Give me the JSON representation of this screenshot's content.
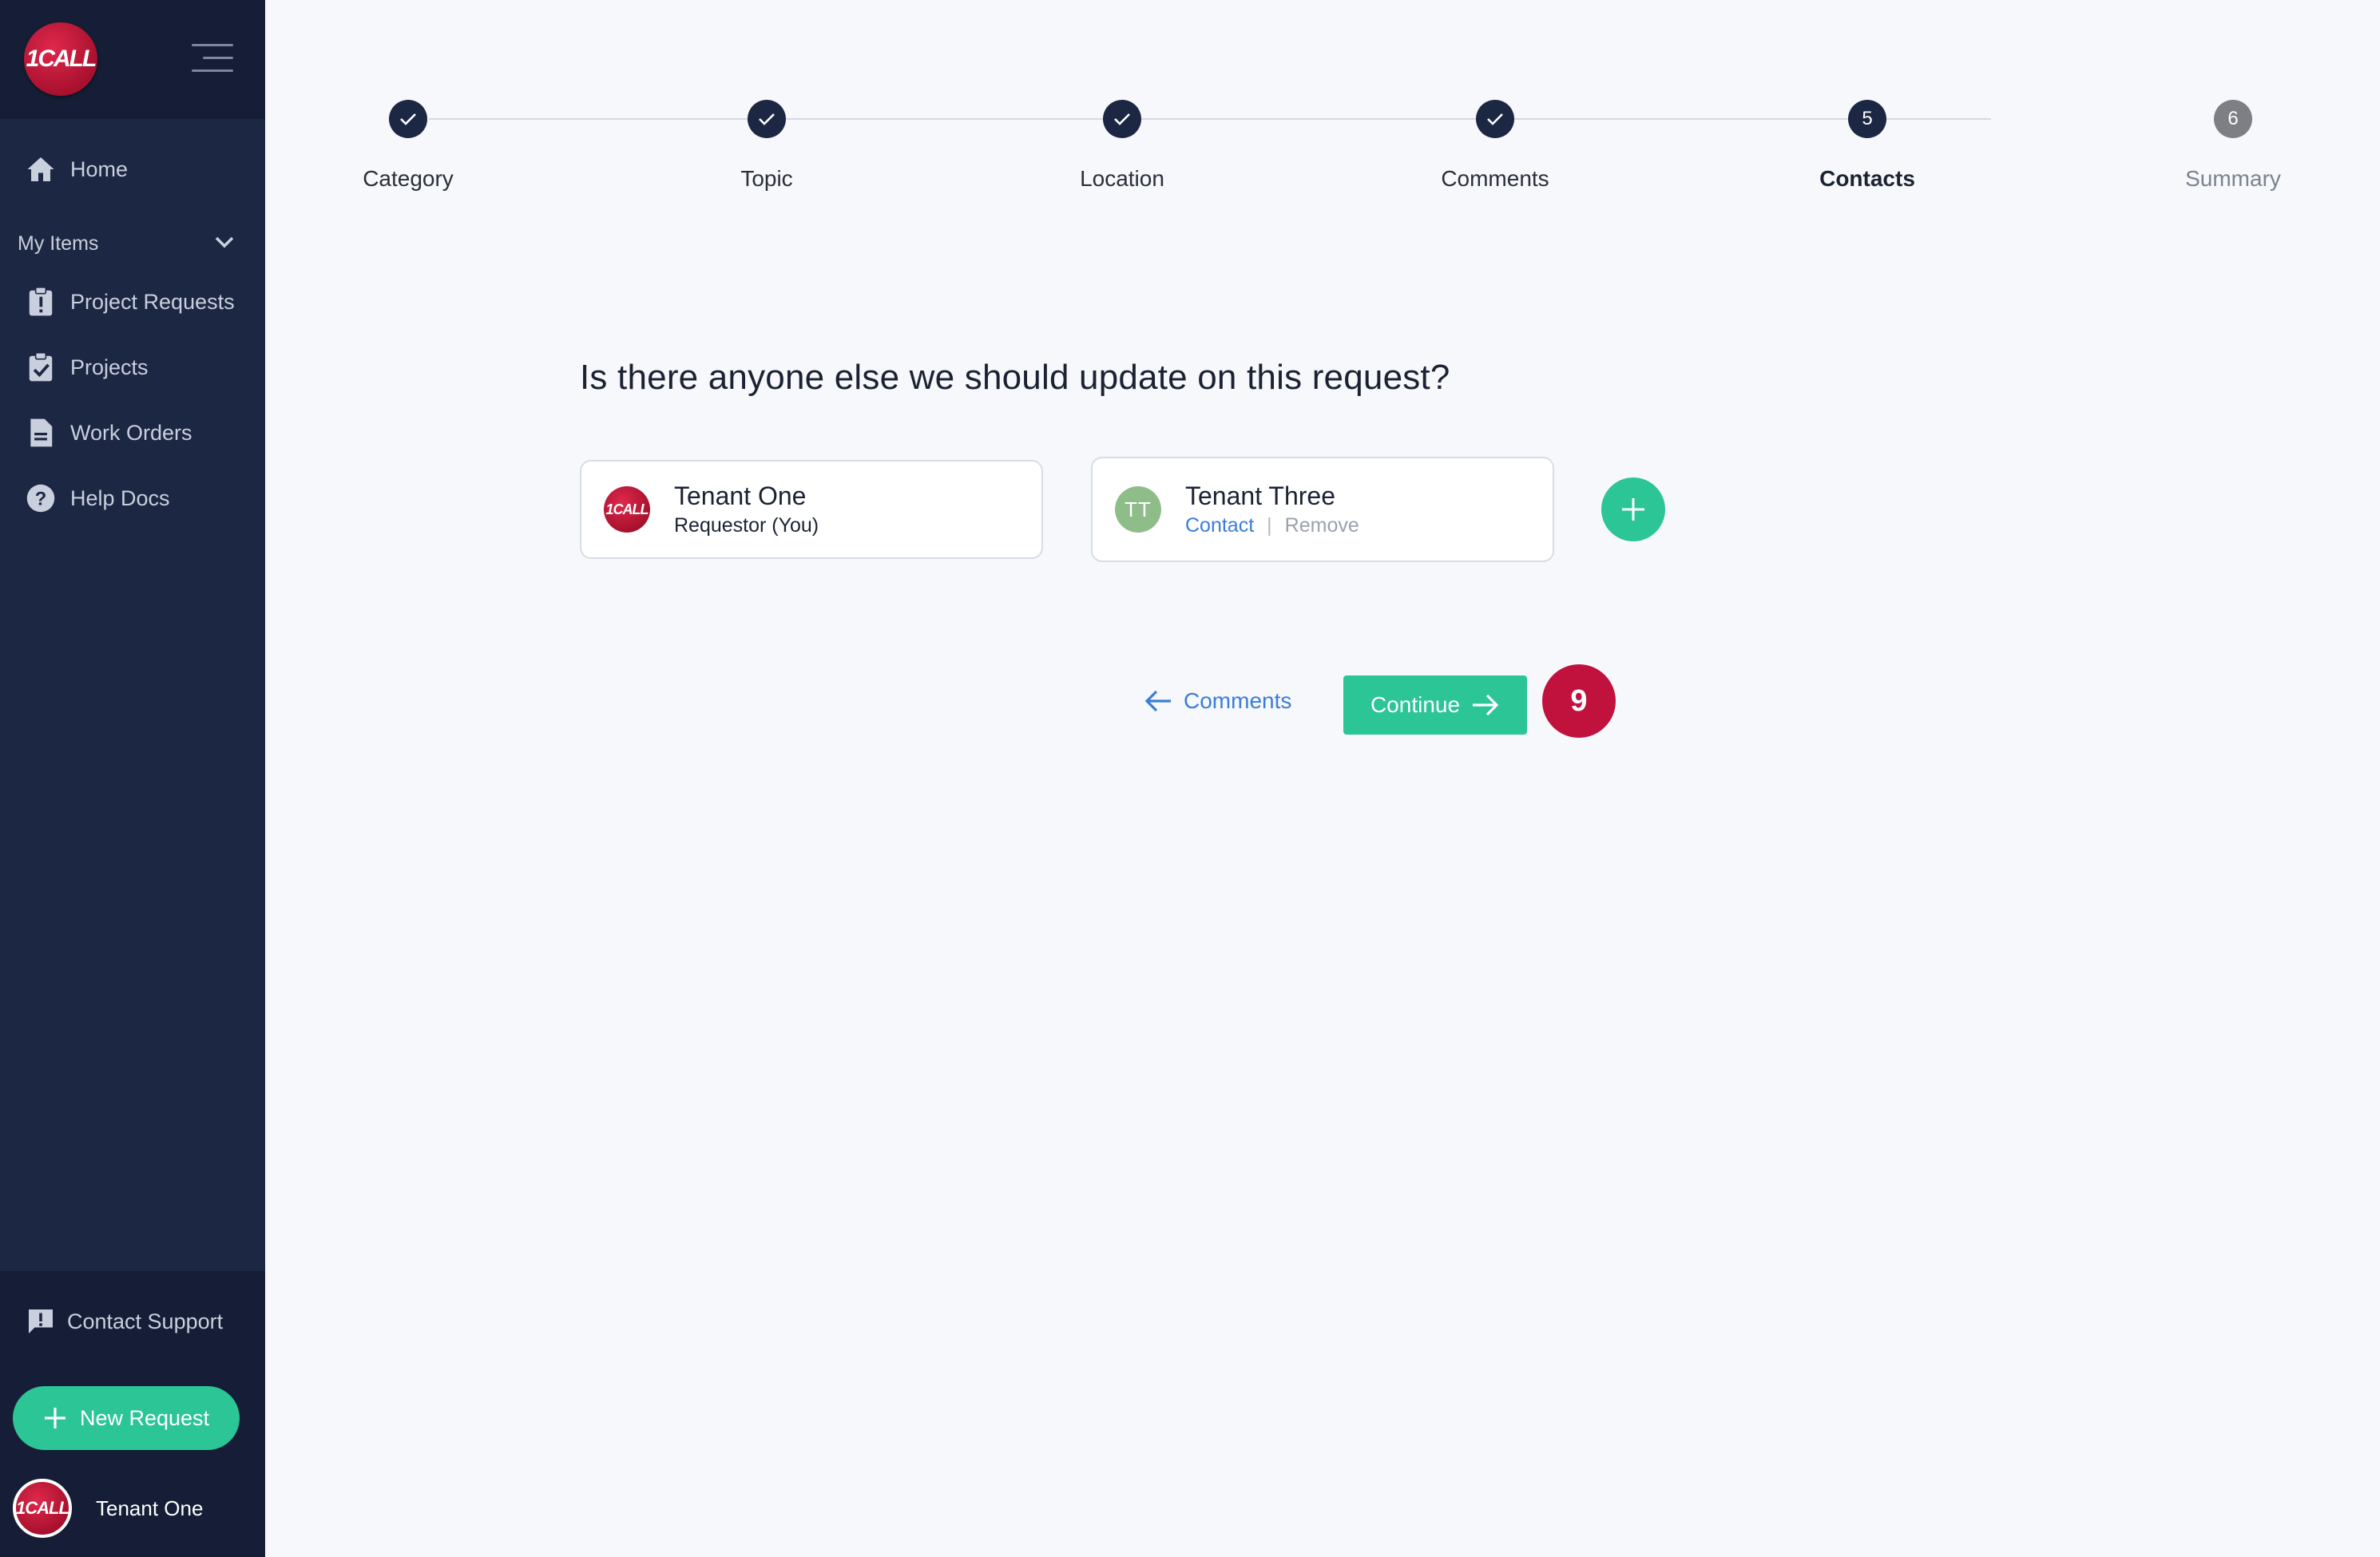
{
  "sidebar": {
    "logo_text": "1CALL",
    "nav": {
      "home": "Home",
      "my_items": "My Items",
      "project_requests": "Project Requests",
      "projects": "Projects",
      "work_orders": "Work Orders",
      "help_docs": "Help Docs"
    },
    "contact_support": "Contact Support",
    "new_request": "New Request",
    "user_name": "Tenant One"
  },
  "stepper": {
    "steps": [
      {
        "label": "Category",
        "state": "done"
      },
      {
        "label": "Topic",
        "state": "done"
      },
      {
        "label": "Location",
        "state": "done"
      },
      {
        "label": "Comments",
        "state": "done"
      },
      {
        "label": "Contacts",
        "number": "5",
        "state": "active"
      },
      {
        "label": "Summary",
        "number": "6",
        "state": "future"
      }
    ]
  },
  "main": {
    "question": "Is there anyone else we should update on this request?",
    "contacts": [
      {
        "name": "Tenant One",
        "role": "Requestor (You)",
        "avatar": "1CALL"
      },
      {
        "name": "Tenant Three",
        "initials": "TT",
        "contact_link": "Contact",
        "separator": "|",
        "remove_link": "Remove"
      }
    ],
    "back_label": "Comments",
    "continue_label": "Continue",
    "badge_count": "9"
  },
  "colors": {
    "sidebar_bg": "#1c2744",
    "accent_green": "#2bc596",
    "link_blue": "#3b7dd8",
    "badge_red": "#c0123d"
  }
}
